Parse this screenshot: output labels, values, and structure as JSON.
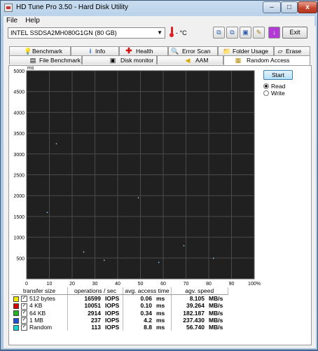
{
  "window": {
    "title": "HD Tune Pro 3.50 - Hard Disk Utility",
    "controls": {
      "minimize": "–",
      "maximize": "□",
      "close": "x"
    }
  },
  "menu": [
    "File",
    "Help"
  ],
  "toolbar": {
    "drive": "INTEL SSDSA2MH080G1GN (80 GB)",
    "temperature": "- °C",
    "exit_label": "Exit",
    "icons": [
      "copy-icon",
      "copy-info-icon",
      "save-icon",
      "options-icon",
      "download-icon"
    ]
  },
  "tabs_top": [
    {
      "label": "Benchmark",
      "icon": "lightbulb-icon"
    },
    {
      "label": "Info",
      "icon": "info-icon"
    },
    {
      "label": "Health",
      "icon": "health-cross-icon"
    },
    {
      "label": "Error Scan",
      "icon": "magnifier-icon"
    },
    {
      "label": "Folder Usage",
      "icon": "folder-icon"
    },
    {
      "label": "Erase",
      "icon": "eraser-icon"
    }
  ],
  "tabs_bottom": [
    {
      "label": "File Benchmark",
      "icon": "file-icon"
    },
    {
      "label": "Disk monitor",
      "icon": "monitor-icon"
    },
    {
      "label": "AAM",
      "icon": "speaker-icon"
    },
    {
      "label": "Random Access",
      "icon": "random-access-icon",
      "active": true
    }
  ],
  "controls": {
    "start_label": "Start",
    "mode_options": [
      "Read",
      "Write"
    ],
    "selected_mode": "Read"
  },
  "chart_data": {
    "type": "scatter",
    "ylabel": "ms",
    "xlabel": "",
    "ylim": [
      0,
      5000
    ],
    "xlim": [
      0,
      100
    ],
    "x_unit": "%",
    "yticks": [
      500,
      1000,
      1500,
      2000,
      2500,
      3000,
      3500,
      4000,
      4500,
      5000
    ],
    "xticks": [
      0,
      10,
      20,
      30,
      40,
      50,
      60,
      70,
      80,
      90,
      "100%"
    ],
    "grid": true,
    "background": "#202020",
    "points": [
      {
        "x": 13,
        "y": 3250
      },
      {
        "x": 9,
        "y": 1600
      },
      {
        "x": 25,
        "y": 650
      },
      {
        "x": 34,
        "y": 450
      },
      {
        "x": 69,
        "y": 800
      },
      {
        "x": 49,
        "y": 1950
      },
      {
        "x": 58,
        "y": 400
      },
      {
        "x": 82,
        "y": 500
      }
    ]
  },
  "results": {
    "headers": [
      "transfer size",
      "operations / sec",
      "avg. access time",
      "agv. speed"
    ],
    "rows": [
      {
        "color": "#f2e600",
        "size": "512 bytes",
        "ops": "16599",
        "ops_unit": "IOPS",
        "time": "0.06",
        "time_unit": "ms",
        "speed": "8.105",
        "speed_unit": "MB/s"
      },
      {
        "color": "#d40000",
        "size": "4 KB",
        "ops": "10051",
        "ops_unit": "IOPS",
        "time": "0.10",
        "time_unit": "ms",
        "speed": "39.264",
        "speed_unit": "MB/s"
      },
      {
        "color": "#22b422",
        "size": "64 KB",
        "ops": "2914",
        "ops_unit": "IOPS",
        "time": "0.34",
        "time_unit": "ms",
        "speed": "182.187",
        "speed_unit": "MB/s"
      },
      {
        "color": "#2050d8",
        "size": "1 MB",
        "ops": "237",
        "ops_unit": "IOPS",
        "time": "4.2",
        "time_unit": "ms",
        "speed": "237.430",
        "speed_unit": "MB/s"
      },
      {
        "color": "#18d2d2",
        "size": "Random",
        "ops": "113",
        "ops_unit": "IOPS",
        "time": "8.8",
        "time_unit": "ms",
        "speed": "56.740",
        "speed_unit": "MB/s"
      }
    ]
  }
}
